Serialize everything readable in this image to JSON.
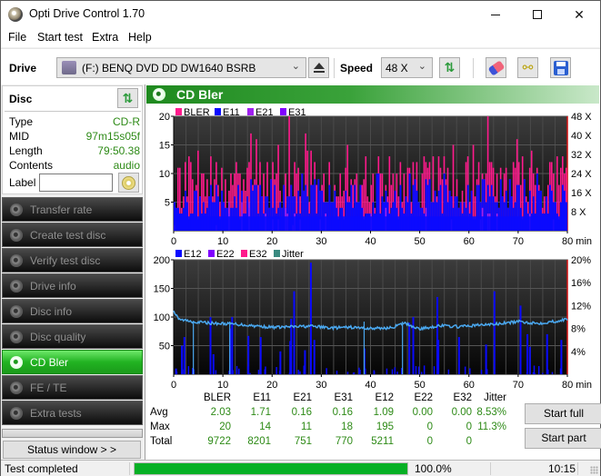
{
  "window": {
    "title": "Opti Drive Control 1.70",
    "controls": {
      "minimize": "—",
      "maximize": "☐",
      "close": "✕"
    }
  },
  "menu": [
    "File",
    "Start test",
    "Extra",
    "Help"
  ],
  "toolbar": {
    "drive_label": "Drive",
    "drive_value": "(F:)  BENQ DVD DD DW1640 BSRB",
    "speed_label": "Speed",
    "speed_value": "48 X",
    "icons": [
      "drive-icon",
      "eject-icon",
      "refresh-icon",
      "eraser-icon",
      "chain-icon",
      "save-icon"
    ]
  },
  "disc": {
    "title": "Disc",
    "rows": [
      {
        "key": "Type",
        "value": "CD-R"
      },
      {
        "key": "MID",
        "value": "97m15s05f"
      },
      {
        "key": "Length",
        "value": "79:50.38"
      },
      {
        "key": "Contents",
        "value": "audio"
      }
    ],
    "label_key": "Label",
    "label_value": ""
  },
  "nav": [
    {
      "label": "Transfer rate",
      "active": false
    },
    {
      "label": "Create test disc",
      "active": false
    },
    {
      "label": "Verify test disc",
      "active": false
    },
    {
      "label": "Drive info",
      "active": false
    },
    {
      "label": "Disc info",
      "active": false
    },
    {
      "label": "Disc quality",
      "active": false
    },
    {
      "label": "CD Bler",
      "active": true
    },
    {
      "label": "FE / TE",
      "active": false
    },
    {
      "label": "Extra tests",
      "active": false
    }
  ],
  "status_window_label": "Status window > >",
  "main": {
    "title": "CD Bler",
    "start_full": "Start full",
    "start_part": "Start part"
  },
  "chart_data": [
    {
      "type": "bar",
      "title": "",
      "legend": [
        {
          "name": "BLER",
          "color": "#ff1a8c"
        },
        {
          "name": "E11",
          "color": "#0a0aff"
        },
        {
          "name": "E21",
          "color": "#a020f0"
        },
        {
          "name": "E31",
          "color": "#8000ff"
        }
      ],
      "legend_placement": "top-left",
      "xlabel": "min",
      "xlim": [
        0,
        80
      ],
      "x_ticks": [
        "0",
        "10",
        "20",
        "30",
        "40",
        "50",
        "60",
        "70",
        "80 min"
      ],
      "ylim": [
        0,
        20
      ],
      "y_ticks": [
        "5",
        "10",
        "15",
        "20"
      ],
      "y2_ticks": [
        "8 X",
        "16 X",
        "24 X",
        "32 X",
        "40 X",
        "48 X"
      ],
      "y2lim": [
        0,
        48
      ],
      "grid": true,
      "series_summary": {
        "BLER": {
          "avg": 2.03,
          "max": 20,
          "typical_range": [
            5,
            18
          ]
        },
        "E11": {
          "avg": 1.71,
          "max": 14,
          "typical_range": [
            3,
            10
          ]
        },
        "E21": {
          "avg": 0.16,
          "max": 11
        },
        "E31": {
          "avg": 0.16,
          "max": 18
        }
      }
    },
    {
      "type": "bar",
      "title": "",
      "legend": [
        {
          "name": "E12",
          "color": "#0a0aff"
        },
        {
          "name": "E22",
          "color": "#8000ff"
        },
        {
          "name": "E32",
          "color": "#ff1a8c"
        },
        {
          "name": "Jitter",
          "color": "#3a8a80"
        }
      ],
      "legend_placement": "top-left",
      "xlabel": "min",
      "xlim": [
        0,
        80
      ],
      "x_ticks": [
        "0",
        "10",
        "20",
        "30",
        "40",
        "50",
        "60",
        "70",
        "80 min"
      ],
      "ylim": [
        0,
        200
      ],
      "y_ticks": [
        "50",
        "100",
        "150",
        "200"
      ],
      "y2_ticks": [
        "4%",
        "8%",
        "12%",
        "16%",
        "20%"
      ],
      "y2lim": [
        0,
        20
      ],
      "grid": true,
      "jitter_line": {
        "x": [
          0,
          1,
          4,
          8,
          12,
          16,
          20,
          24,
          28,
          32,
          36,
          40,
          44,
          47,
          50,
          54,
          58,
          62,
          66,
          70,
          74,
          78,
          80
        ],
        "y_percent": [
          11.0,
          9.6,
          9.2,
          8.9,
          8.8,
          8.5,
          8.2,
          8.3,
          8.4,
          8.1,
          8.2,
          8.0,
          8.1,
          8.9,
          7.9,
          8.5,
          8.3,
          8.6,
          8.8,
          9.2,
          8.9,
          9.3,
          9.6
        ]
      },
      "e12_spikes": {
        "x": [
          0.3,
          1.5,
          2.0,
          7.3,
          7.9,
          11.3,
          11.7,
          15.0,
          17.5,
          21.5,
          23.5,
          23.7,
          24.3,
          26.5,
          27.7,
          28.4,
          38.6,
          46.2,
          47.7,
          48.5,
          53.4,
          53.6,
          57.8,
          63.3,
          65.0,
          70.3,
          71.7,
          72.2,
          75.7,
          78.6
        ],
        "y": [
          10,
          50,
          65,
          100,
          35,
          80,
          100,
          67,
          65,
          40,
          58,
          97,
          145,
          42,
          195,
          60,
          45,
          11,
          90,
          100,
          135,
          60,
          65,
          52,
          145,
          120,
          70,
          48,
          70,
          60
        ]
      },
      "series_summary": {
        "E12": {
          "avg": 1.09,
          "max": 195
        },
        "E22": {
          "avg": 0.0,
          "max": 0
        },
        "E32": {
          "avg": 0.0,
          "max": 0
        },
        "Jitter": {
          "avg": "8.53%",
          "max": "11.3%"
        }
      }
    }
  ],
  "stats": {
    "columns": [
      "BLER",
      "E11",
      "E21",
      "E31",
      "E12",
      "E22",
      "E32",
      "Jitter"
    ],
    "rows": [
      {
        "label": "Avg",
        "values": [
          "2.03",
          "1.71",
          "0.16",
          "0.16",
          "1.09",
          "0.00",
          "0.00",
          "8.53%"
        ]
      },
      {
        "label": "Max",
        "values": [
          "20",
          "14",
          "11",
          "18",
          "195",
          "0",
          "0",
          "11.3%"
        ]
      },
      {
        "label": "Total",
        "values": [
          "9722",
          "8201",
          "751",
          "770",
          "5211",
          "0",
          "0",
          ""
        ]
      }
    ]
  },
  "statusbar": {
    "text": "Test completed",
    "progress": 1.0,
    "percent_text": "100.0%",
    "time": "10:15"
  }
}
